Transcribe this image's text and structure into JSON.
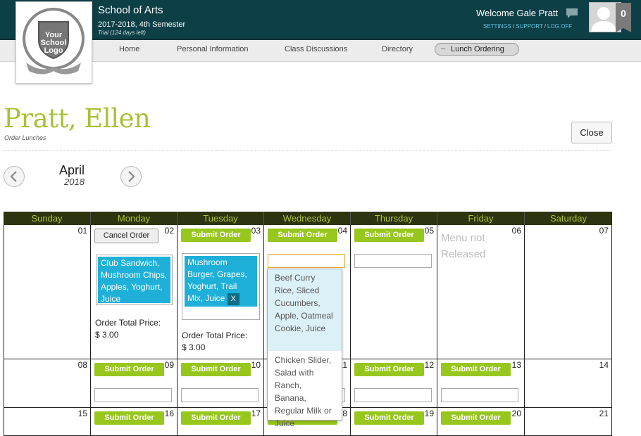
{
  "header": {
    "school_name": "School of Arts",
    "term": "2017-2018, 4th Semester",
    "trial": "Trial (124 days left)",
    "welcome": "Welcome Gale Pratt",
    "links": [
      "SETTINGS",
      "SUPPORT",
      "LOG OFF"
    ],
    "notification_count": "0",
    "logo_text": "Your School Logo"
  },
  "nav": {
    "items": [
      "Home",
      "Personal Information",
      "Class Discussions",
      "Directory"
    ],
    "active": "Lunch Ordering"
  },
  "page": {
    "student_name": "Pratt, Ellen",
    "subtitle": "Order Lunches",
    "close_label": "Close"
  },
  "calendar": {
    "month": "April",
    "year": "2018",
    "days": [
      "Sunday",
      "Monday",
      "Tuesday",
      "Wednesday",
      "Thursday",
      "Friday",
      "Saturday"
    ],
    "submit_label": "Submit Order",
    "cancel_label": "Cancel Order",
    "remove_label": "X",
    "menu_not_released": "Menu not Released",
    "total_label": "Order Total Price:",
    "week1": {
      "dates": [
        "01",
        "02",
        "03",
        "04",
        "05",
        "06",
        "07"
      ],
      "monday_order": "Club Sandwich, Mushroom Chips, Apples, Yoghurt, Juice",
      "monday_total": "$ 3.00",
      "tuesday_order": "Mushroom Burger, Grapes, Yoghurt, Trail Mix, Juice",
      "tuesday_total": "$ 3.00"
    },
    "week2": {
      "dates": [
        "08",
        "09",
        "10",
        "11",
        "12",
        "13",
        "14"
      ]
    },
    "week3": {
      "dates": [
        "15",
        "16",
        "17",
        "18",
        "19",
        "20",
        "21"
      ]
    }
  },
  "dropdown": {
    "options": [
      "Beef Curry Rice, Sliced Cucumbers, Apple, Oatmeal Cookie, Juice",
      "Chicken Slider, Salad with Ranch, Banana, Regular Milk or Juice"
    ]
  },
  "colors": {
    "header_bg": "#0d3f47",
    "accent_green": "#97c61d",
    "name_green": "#a7c236",
    "chip_blue": "#1eb0d8",
    "day_header_bg": "#2d3410"
  }
}
